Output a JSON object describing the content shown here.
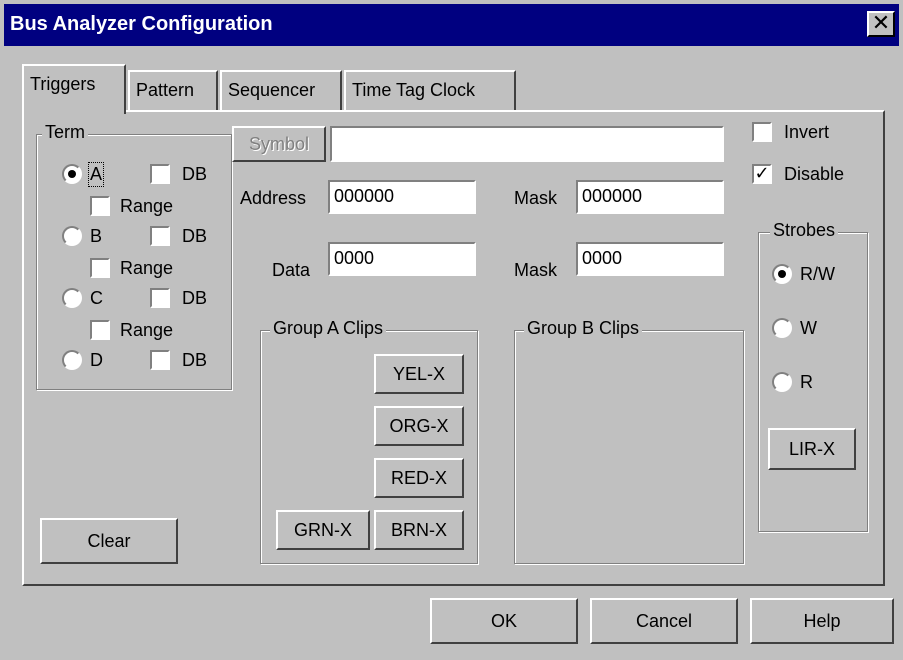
{
  "window": {
    "title": "Bus Analyzer Configuration",
    "close_glyph": "✕"
  },
  "tabs": [
    {
      "label": "Triggers",
      "active": true
    },
    {
      "label": "Pattern",
      "active": false
    },
    {
      "label": "Sequencer",
      "active": false
    },
    {
      "label": "Time Tag Clock",
      "active": false
    }
  ],
  "term": {
    "label": "Term",
    "options": [
      {
        "label": "A",
        "selected": true,
        "db_label": "DB",
        "db_checked": false,
        "range_label": "Range",
        "range_checked": false
      },
      {
        "label": "B",
        "selected": false,
        "db_label": "DB",
        "db_checked": false,
        "range_label": "Range",
        "range_checked": false
      },
      {
        "label": "C",
        "selected": false,
        "db_label": "DB",
        "db_checked": false,
        "range_label": "Range",
        "range_checked": false
      },
      {
        "label": "D",
        "selected": false,
        "db_label": "DB",
        "db_checked": false
      }
    ]
  },
  "symbol": {
    "button_label": "Symbol",
    "value": ""
  },
  "address": {
    "label": "Address",
    "value": "000000",
    "mask_label": "Mask",
    "mask_value": "000000"
  },
  "data": {
    "label": "Data",
    "value": "0000",
    "mask_label": "Mask",
    "mask_value": "0000"
  },
  "options": {
    "invert": {
      "label": "Invert",
      "checked": false
    },
    "disable": {
      "label": "Disable",
      "checked": true
    }
  },
  "strobes": {
    "label": "Strobes",
    "options": [
      {
        "label": "R/W",
        "selected": true
      },
      {
        "label": "W",
        "selected": false
      },
      {
        "label": "R",
        "selected": false
      }
    ],
    "button_label": "LIR-X"
  },
  "group_a": {
    "label": "Group A Clips",
    "buttons": [
      "YEL-X",
      "ORG-X",
      "RED-X",
      "GRN-X",
      "BRN-X"
    ]
  },
  "group_b": {
    "label": "Group B Clips"
  },
  "clear_label": "Clear",
  "footer": {
    "ok": "OK",
    "cancel": "Cancel",
    "help": "Help"
  }
}
